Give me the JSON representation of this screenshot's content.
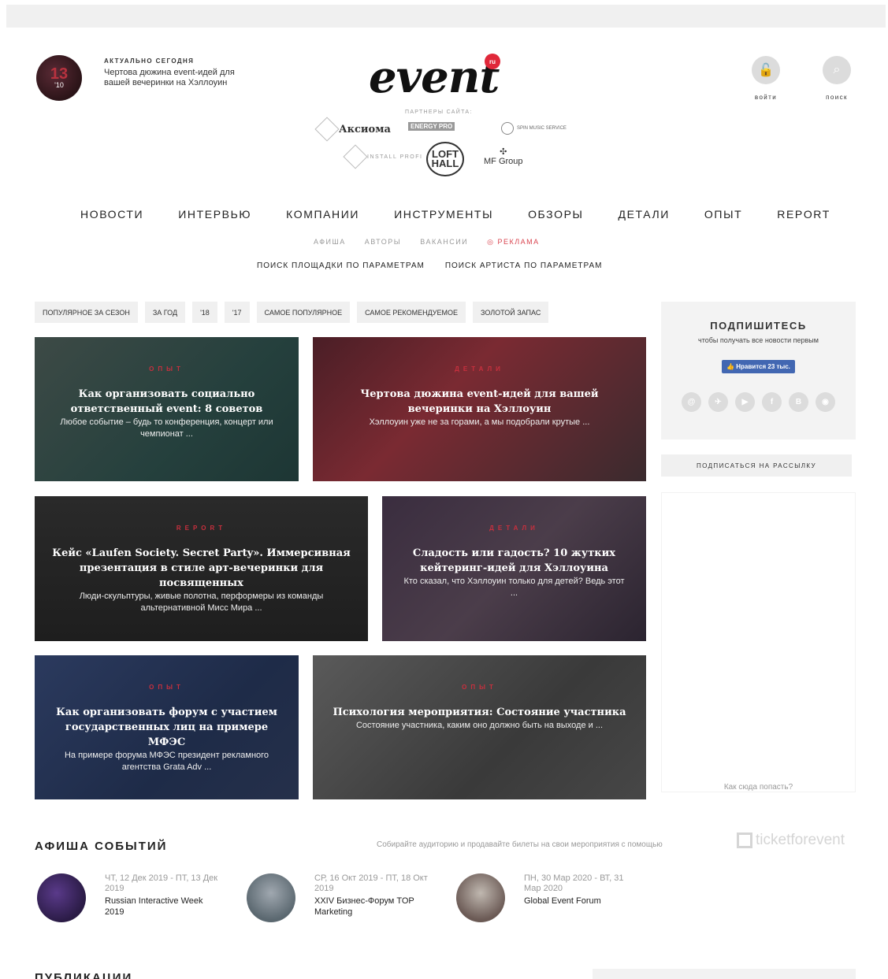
{
  "header": {
    "today_label": "АКТУАЛЬНО СЕГОДНЯ",
    "today_badge_num": "13",
    "today_badge_year": "'10",
    "today_title": "Чертова дюжина event-идей для вашей вечеринки на Хэллоуин",
    "logo": "event",
    "logo_badge": "ru",
    "partners_label": "ПАРТНЕРЫ САЙТА:",
    "partners": {
      "axioma": "Аксиома",
      "energy": "ENERGY PRO",
      "spin": "SPIN MUSIC SERVICE",
      "install": "INSTALL PROFI",
      "loft": "LOFT HALL",
      "mf": "MF Group"
    },
    "login_label": "войти",
    "search_label": "поиск"
  },
  "nav": {
    "main": [
      "НОВОСТИ",
      "ИНТЕРВЬЮ",
      "КОМПАНИИ",
      "ИНСТРУМЕНТЫ",
      "ОБЗОРЫ",
      "ДЕТАЛИ",
      "ОПЫТ",
      "REPORT"
    ],
    "sub": [
      "АФИША",
      "АВТОРЫ",
      "ВАКАНСИИ",
      "РЕКЛАМА"
    ],
    "search": [
      "ПОИСК ПЛОЩАДКИ ПО ПАРАМЕТРАМ",
      "ПОИСК АРТИСТА ПО ПАРАМЕТРАМ"
    ]
  },
  "filters": [
    "ПОПУЛЯРНОЕ ЗА СЕЗОН",
    "ЗА ГОД",
    "'18",
    "'17",
    "САМОЕ ПОПУЛЯРНОЕ",
    "САМОЕ РЕКОМЕНДУЕМОЕ",
    "ЗОЛОТОЙ ЗАПАС"
  ],
  "cards": [
    {
      "category": "ОПЫТ",
      "title": "Как организовать социально ответственный event: 8 советов",
      "desc": "Любое событие – будь то конференция, концерт или чемпионат ..."
    },
    {
      "category": "ДЕТАЛИ",
      "title": "Чертова дюжина event-идей для вашей вечеринки на Хэллоуин",
      "desc": "Хэллоуин уже не за горами, а мы подобрали крутые ..."
    },
    {
      "category": "REPORT",
      "title": "Кейс «Laufen Society. Secret Party». Иммерсивная презентация в стиле арт-вечеринки для посвященных",
      "desc": "Люди-скульптуры, живые полотна, перформеры из команды альтернативной Мисс Мира ..."
    },
    {
      "category": "ДЕТАЛИ",
      "title": "Сладость или гадость? 10 жутких кейтеринг-идей для Хэллоуина",
      "desc": "Кто сказал, что Хэллоуин только для детей? Ведь этот ..."
    },
    {
      "category": "ОПЫТ",
      "title": "Как организовать форум с участием государственных лиц на примере МФЭС",
      "desc": "На примере форума МФЭС президент рекламного агентства Grata Adv ..."
    },
    {
      "category": "ОПЫТ",
      "title": "Психология мероприятия: Состояние участника",
      "desc": "Состояние участника, каким оно должно быть на выходе и ..."
    }
  ],
  "sidebar": {
    "subscribe_title": "ПОДПИШИТЕСЬ",
    "subscribe_sub": "чтобы получать все новости первым",
    "fb_like": "👍 Нравится 23 тыс.",
    "socials": [
      "@",
      "✈",
      "▶",
      "f",
      "В",
      "◉"
    ],
    "newsletter": "ПОДПИСАТЬСЯ НА РАССЫЛКУ",
    "ad_how": "Как сюда попасть?"
  },
  "afisha": {
    "title": "АФИША СОБЫТИЙ",
    "promo": "Собирайте аудиторию и продавайте билеты на свои мероприятия с помощью",
    "tfe_logo": "ticketforevent",
    "events": [
      {
        "date": "ЧТ, 12 Дек 2019 - ПТ, 13 Дек 2019",
        "name": "Russian Interactive Week 2019"
      },
      {
        "date": "СР, 16 Окт 2019 - ПТ, 18 Окт 2019",
        "name": "XXIV Бизнес-Форум TOP Marketing"
      },
      {
        "date": "ПН, 30 Мар 2020 - ВТ, 31 Мар 2020",
        "name": "Global Event Forum"
      }
    ]
  },
  "publications": {
    "title": "ПУБЛИКАЦИИ"
  }
}
